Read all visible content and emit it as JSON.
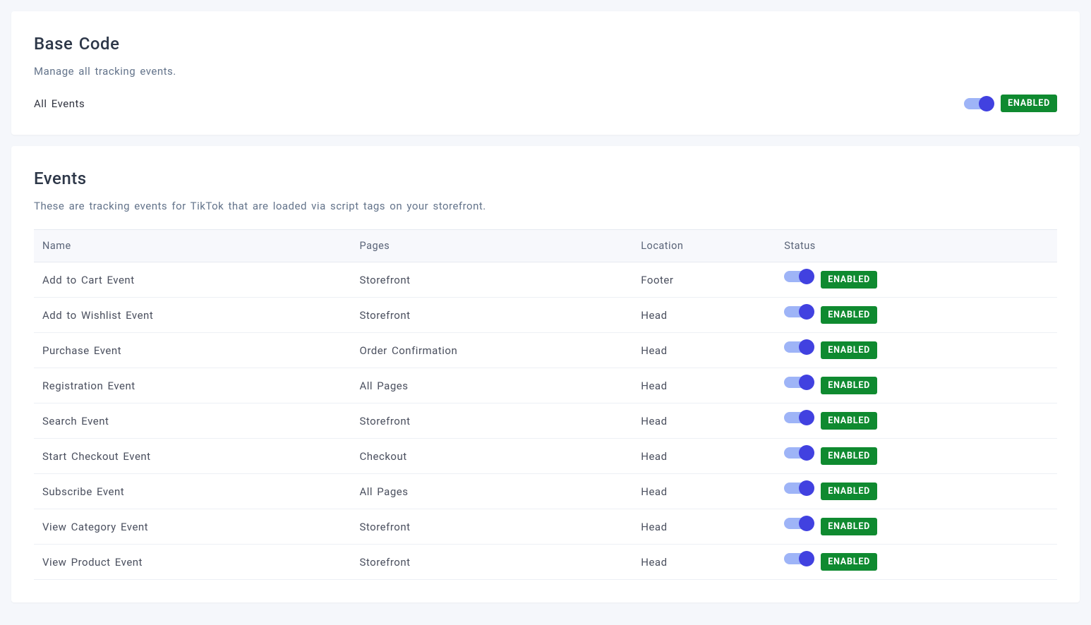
{
  "baseCode": {
    "title": "Base Code",
    "subtitle": "Manage all tracking events.",
    "allEventsLabel": "All Events",
    "allEventsEnabled": true,
    "enabledBadge": "ENABLED"
  },
  "events": {
    "title": "Events",
    "subtitle": "These are tracking events for TikTok that are loaded via script tags on your storefront.",
    "columns": {
      "name": "Name",
      "pages": "Pages",
      "location": "Location",
      "status": "Status"
    },
    "rows": [
      {
        "name": "Add to Cart Event",
        "pages": "Storefront",
        "location": "Footer",
        "enabled": true,
        "badge": "ENABLED"
      },
      {
        "name": "Add to Wishlist Event",
        "pages": "Storefront",
        "location": "Head",
        "enabled": true,
        "badge": "ENABLED"
      },
      {
        "name": "Purchase Event",
        "pages": "Order Confirmation",
        "location": "Head",
        "enabled": true,
        "badge": "ENABLED"
      },
      {
        "name": "Registration Event",
        "pages": "All Pages",
        "location": "Head",
        "enabled": true,
        "badge": "ENABLED"
      },
      {
        "name": "Search Event",
        "pages": "Storefront",
        "location": "Head",
        "enabled": true,
        "badge": "ENABLED"
      },
      {
        "name": "Start Checkout Event",
        "pages": "Checkout",
        "location": "Head",
        "enabled": true,
        "badge": "ENABLED"
      },
      {
        "name": "Subscribe Event",
        "pages": "All Pages",
        "location": "Head",
        "enabled": true,
        "badge": "ENABLED"
      },
      {
        "name": "View Category Event",
        "pages": "Storefront",
        "location": "Head",
        "enabled": true,
        "badge": "ENABLED"
      },
      {
        "name": "View Product Event",
        "pages": "Storefront",
        "location": "Head",
        "enabled": true,
        "badge": "ENABLED"
      }
    ]
  }
}
